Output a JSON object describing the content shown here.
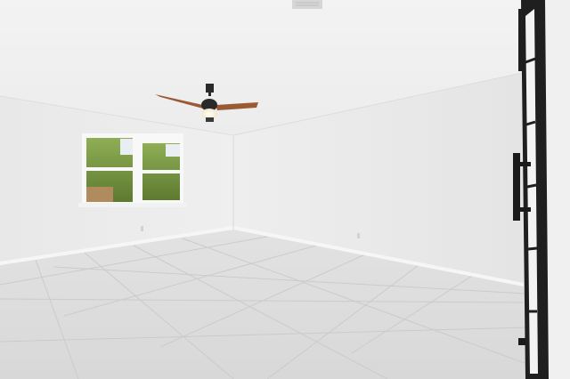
{
  "scene": {
    "subject": "empty-room",
    "colors": {
      "ceiling": "#f1f1f1",
      "left_wall": "#ebebeb",
      "back_wall": "#e7e7e7",
      "floor": "#dcdcdc",
      "grout": "#c9c9c9",
      "baseboard": "#f6f6f6",
      "fan_blade": "#9a5a34",
      "fan_metal": "#2a2a2a",
      "fan_light": "#fff6e0",
      "door_frame": "#1f1f1f",
      "door_glass": "#f4f4f4",
      "foliage": "#6f8f3a",
      "window_frame": "#f8f8f8"
    },
    "icons": [
      "ceiling-fan-icon",
      "door-handle-icon",
      "vent-icon",
      "outlet-icon"
    ]
  }
}
